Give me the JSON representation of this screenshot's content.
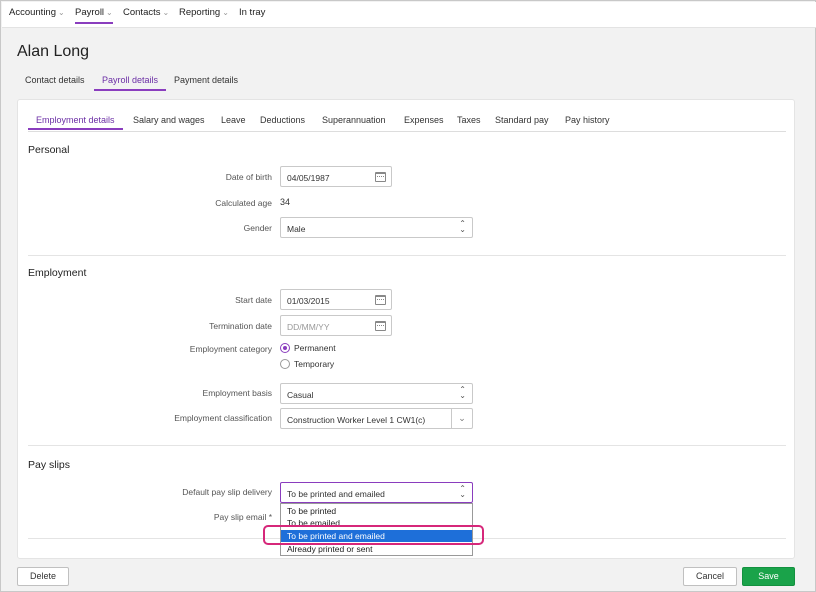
{
  "nav": {
    "items": [
      {
        "label": "Accounting",
        "chevron": true
      },
      {
        "label": "Payroll",
        "chevron": true
      },
      {
        "label": "Contacts",
        "chevron": true
      },
      {
        "label": "Reporting",
        "chevron": true
      },
      {
        "label": "In tray",
        "chevron": false
      }
    ],
    "active": "Payroll"
  },
  "page": {
    "title": "Alan Long"
  },
  "section_tabs": [
    "Contact details",
    "Payroll details",
    "Payment details"
  ],
  "sub_tabs": [
    "Employment details",
    "Salary and wages",
    "Leave",
    "Deductions",
    "Superannuation",
    "Expenses",
    "Taxes",
    "Standard pay",
    "Pay history"
  ],
  "personal": {
    "title": "Personal",
    "dob_label": "Date of birth",
    "dob_value": "04/05/1987",
    "age_label": "Calculated age",
    "age_value": "34",
    "gender_label": "Gender",
    "gender_value": "Male"
  },
  "employment": {
    "title": "Employment",
    "start_label": "Start date",
    "start_value": "01/03/2015",
    "term_label": "Termination date",
    "term_placeholder": "DD/MM/YY",
    "category_label": "Employment category",
    "category_options": [
      "Permanent",
      "Temporary"
    ],
    "category_selected": "Permanent",
    "basis_label": "Employment basis",
    "basis_value": "Casual",
    "class_label": "Employment classification",
    "class_value": "Construction Worker Level 1 CW1(c)"
  },
  "payslips": {
    "title": "Pay slips",
    "delivery_label": "Default pay slip delivery",
    "delivery_value": "To be printed and emailed",
    "email_label": "Pay slip email *",
    "options": [
      "To be printed",
      "To be emailed",
      "To be printed and emailed",
      "Already printed or sent"
    ],
    "selected": "To be printed and emailed"
  },
  "footer": {
    "delete": "Delete",
    "cancel": "Cancel",
    "save": "Save"
  },
  "colors": {
    "accent": "#8a3dbe",
    "save": "#1aa34a",
    "highlight": "#d6277a",
    "selection": "#1e6fd9"
  }
}
